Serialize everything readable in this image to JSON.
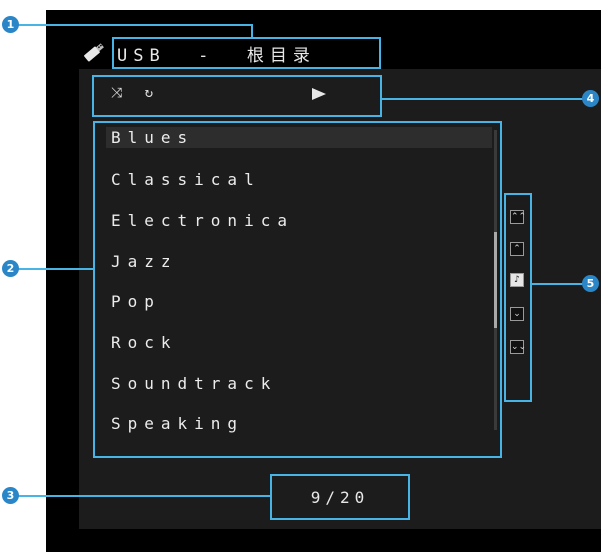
{
  "header": {
    "source_title": "USB  -  根目录"
  },
  "playback": {
    "shuffle_symbol": "⤨",
    "repeat_symbol": "↻",
    "play_state_icon": "play-icon"
  },
  "list": {
    "items": [
      {
        "label": "Blues",
        "selected": true
      },
      {
        "label": "Classical",
        "selected": false
      },
      {
        "label": "Electronica",
        "selected": false
      },
      {
        "label": "Jazz",
        "selected": false
      },
      {
        "label": "Pop",
        "selected": false
      },
      {
        "label": "Rock",
        "selected": false
      },
      {
        "label": "Soundtrack",
        "selected": false
      },
      {
        "label": "Speaking",
        "selected": false
      }
    ]
  },
  "scrollbar": {
    "position_fraction": 0.35,
    "visible_fraction": 0.32
  },
  "nav_buttons": [
    {
      "name": "page-up-button",
      "symbol": "⌃⌃"
    },
    {
      "name": "line-up-button",
      "symbol": "⌃"
    },
    {
      "name": "now-playing-button",
      "symbol": "♪"
    },
    {
      "name": "line-down-button",
      "symbol": "⌄"
    },
    {
      "name": "page-down-button",
      "symbol": "⌄⌄"
    }
  ],
  "page_counter": "9/20",
  "callouts": {
    "badge_1": "1",
    "badge_2": "2",
    "badge_3": "3",
    "badge_4": "4",
    "badge_5": "5"
  },
  "colors": {
    "highlight": "#48b4e6",
    "badge": "#2b86c8",
    "screen_bg": "#000000",
    "panel_bg": "#1c1c1c",
    "text": "#ececec"
  }
}
